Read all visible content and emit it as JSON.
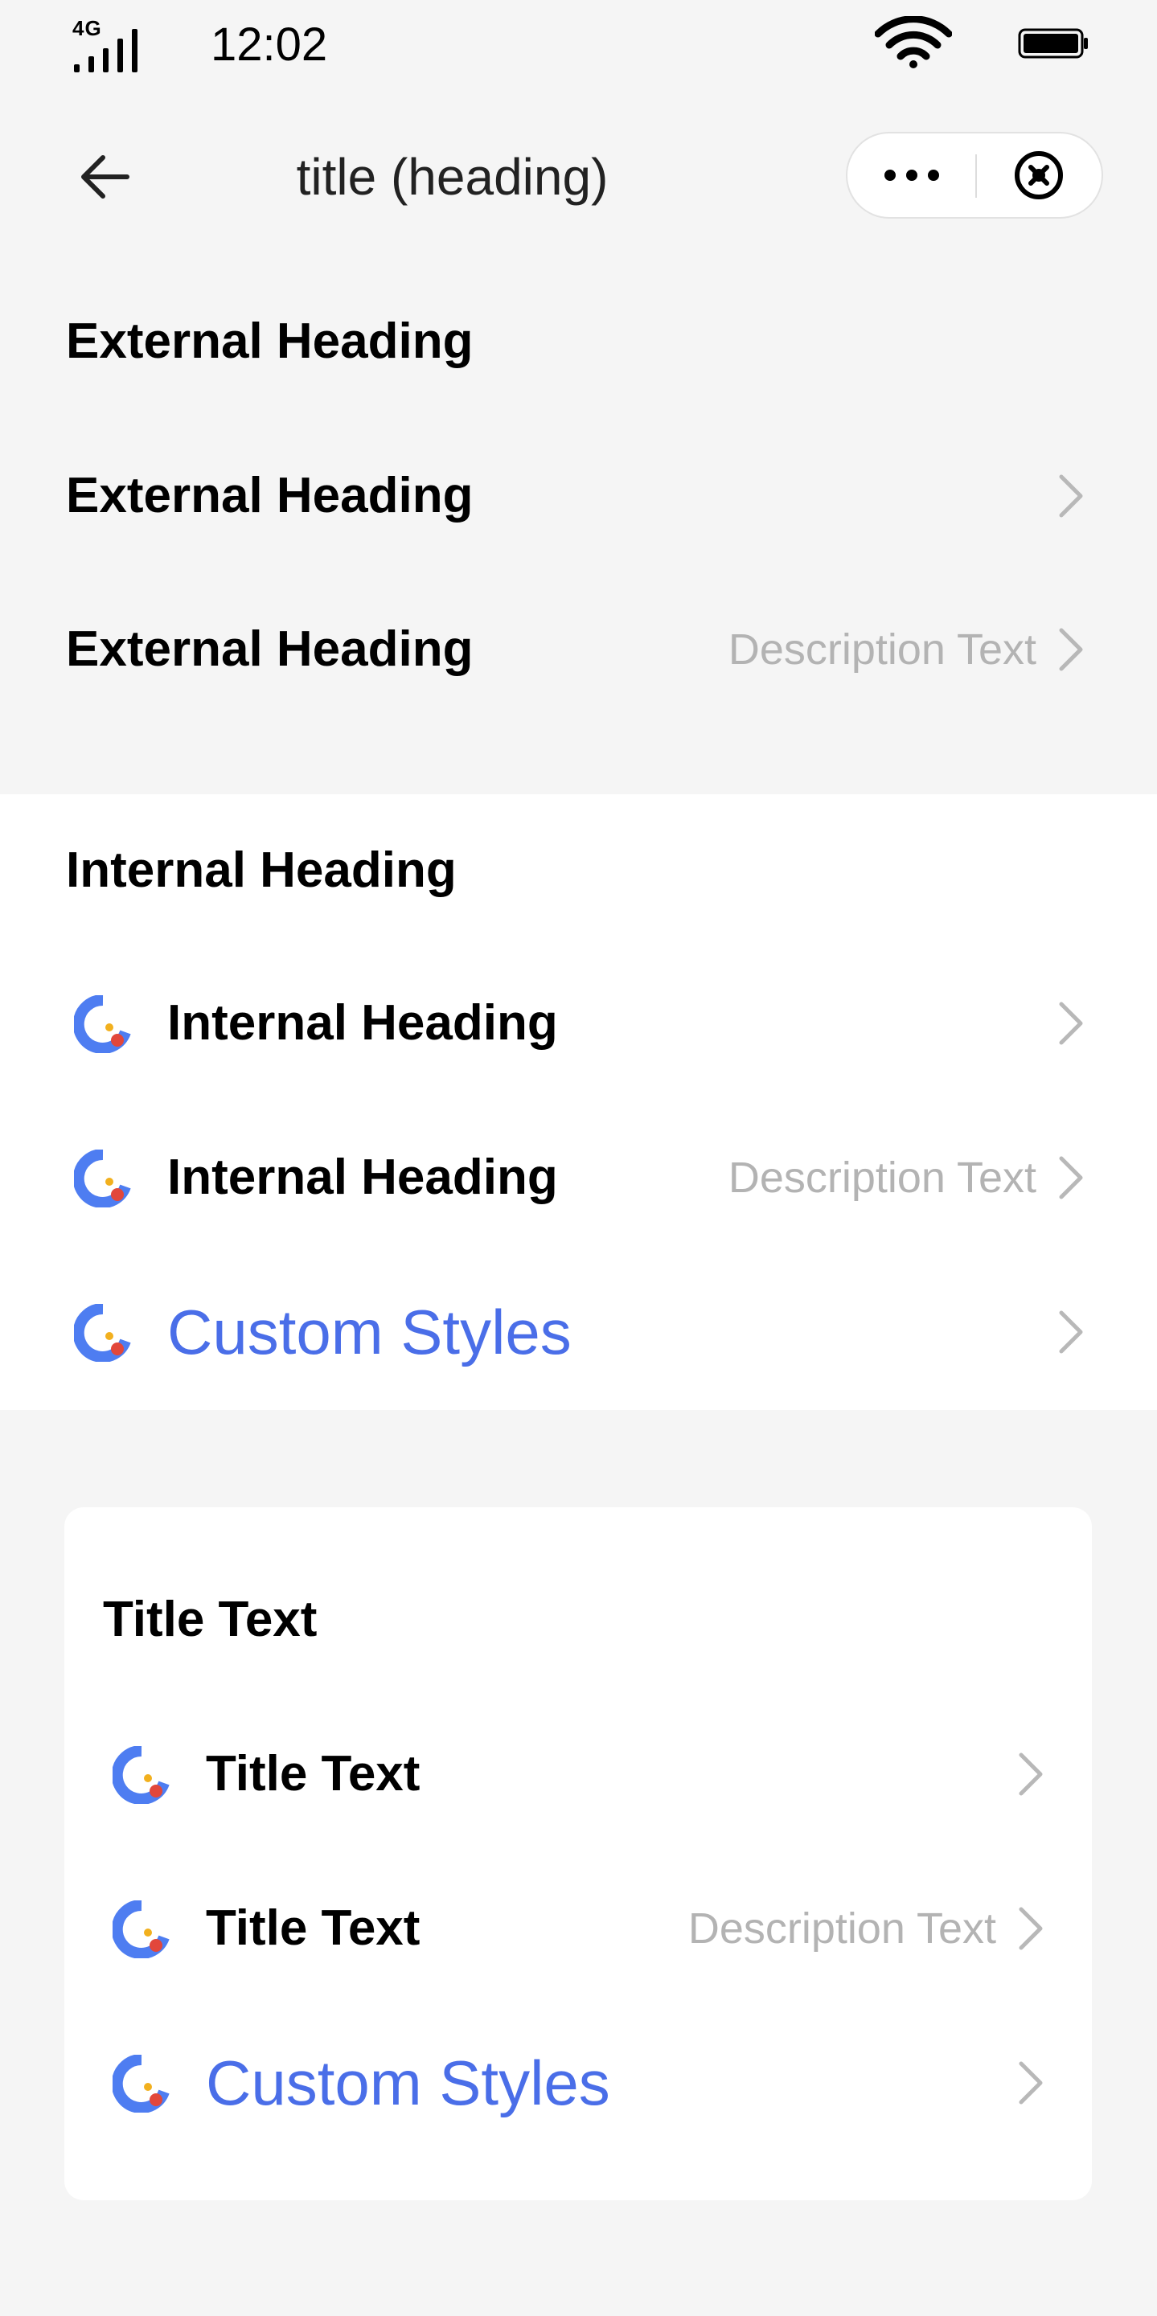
{
  "status_bar": {
    "network": "4G",
    "time": "12:02"
  },
  "nav": {
    "title": "title (heading)"
  },
  "external": {
    "heading_1": "External Heading",
    "heading_2": "External Heading",
    "heading_3": "External Heading",
    "description": "Description Text"
  },
  "internal": {
    "section_title": "Internal Heading",
    "heading_1": "Internal Heading",
    "heading_2": "Internal Heading",
    "description": "Description Text",
    "custom": "Custom Styles"
  },
  "card": {
    "section_title": "Title Text",
    "title_1": "Title Text",
    "title_2": "Title Text",
    "description": "Description Text",
    "custom": "Custom Styles"
  },
  "colors": {
    "accent_blue": "#4a6ee8",
    "icon_blue": "#4e7df1",
    "icon_red": "#e2473b",
    "icon_yellow": "#f2b01e",
    "description_gray": "#b3b3b3"
  }
}
